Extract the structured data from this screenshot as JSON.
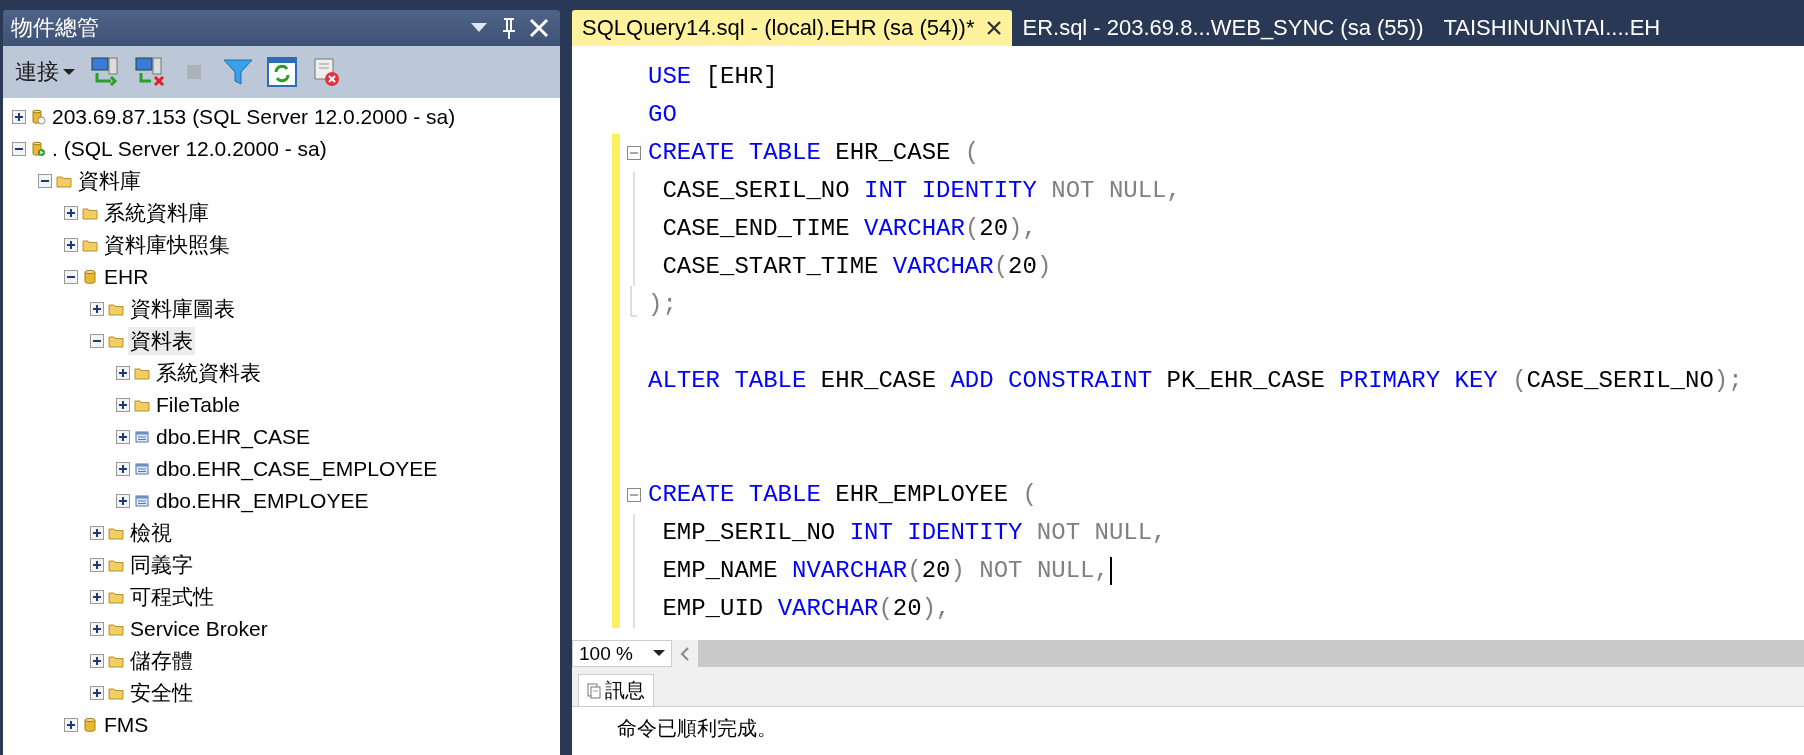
{
  "object_explorer": {
    "title": "物件總管",
    "toolbar": {
      "connect_label": "連接",
      "buttons": [
        {
          "kind": "connect",
          "disabled": false
        },
        {
          "kind": "disconnect",
          "disabled": false
        },
        {
          "kind": "stop",
          "disabled": true
        },
        {
          "kind": "filter",
          "disabled": false
        },
        {
          "kind": "refresh",
          "disabled": false
        },
        {
          "kind": "script-cancel",
          "disabled": false
        }
      ]
    },
    "tree": [
      {
        "kind": "server",
        "label": "203.69.87.153 (SQL Server 12.0.2000 - sa)",
        "expanded": false,
        "selected": false
      },
      {
        "kind": "server-connected",
        "label": ". (SQL Server 12.0.2000 - sa)",
        "expanded": true,
        "selected": false,
        "children": [
          {
            "kind": "folder",
            "label": "資料庫",
            "expanded": true,
            "selected": false,
            "children": [
              {
                "kind": "folder",
                "label": "系統資料庫",
                "expanded": false,
                "selected": false
              },
              {
                "kind": "folder",
                "label": "資料庫快照集",
                "expanded": false,
                "selected": false
              },
              {
                "kind": "database",
                "label": "EHR",
                "expanded": true,
                "selected": false,
                "children": [
                  {
                    "kind": "folder",
                    "label": "資料庫圖表",
                    "expanded": false,
                    "selected": false
                  },
                  {
                    "kind": "folder",
                    "label": "資料表",
                    "expanded": true,
                    "selected": true,
                    "children": [
                      {
                        "kind": "folder",
                        "label": "系統資料表",
                        "expanded": false,
                        "selected": false
                      },
                      {
                        "kind": "folder",
                        "label": "FileTable",
                        "expanded": false,
                        "selected": false
                      },
                      {
                        "kind": "table",
                        "label": "dbo.EHR_CASE",
                        "expanded": false,
                        "selected": false
                      },
                      {
                        "kind": "table",
                        "label": "dbo.EHR_CASE_EMPLOYEE",
                        "expanded": false,
                        "selected": false
                      },
                      {
                        "kind": "table",
                        "label": "dbo.EHR_EMPLOYEE",
                        "expanded": false,
                        "selected": false
                      }
                    ]
                  },
                  {
                    "kind": "folder",
                    "label": "檢視",
                    "expanded": false,
                    "selected": false
                  },
                  {
                    "kind": "folder",
                    "label": "同義字",
                    "expanded": false,
                    "selected": false
                  },
                  {
                    "kind": "folder",
                    "label": "可程式性",
                    "expanded": false,
                    "selected": false
                  },
                  {
                    "kind": "folder",
                    "label": "Service Broker",
                    "expanded": false,
                    "selected": false
                  },
                  {
                    "kind": "folder",
                    "label": "儲存體",
                    "expanded": false,
                    "selected": false
                  },
                  {
                    "kind": "folder",
                    "label": "安全性",
                    "expanded": false,
                    "selected": false
                  }
                ]
              },
              {
                "kind": "database",
                "label": "FMS",
                "expanded": false,
                "selected": false
              }
            ]
          }
        ]
      }
    ]
  },
  "editor_tabs": [
    {
      "label": "SQLQuery14.sql - (local).EHR (sa (54))*",
      "selected": true
    },
    {
      "label": "ER.sql - 203.69.8...WEB_SYNC (sa (55))",
      "selected": false
    },
    {
      "label": "TAISHINUNI\\TAI....EH",
      "selected": false
    }
  ],
  "code_lines": [
    {
      "changed": false,
      "kind": "code",
      "cursor": false,
      "tokens": [
        {
          "kind": "keyword",
          "text": "USE"
        },
        {
          "kind": "plain",
          "text": " [EHR]"
        }
      ]
    },
    {
      "changed": false,
      "kind": "code",
      "cursor": false,
      "tokens": [
        {
          "kind": "keyword",
          "text": "GO"
        }
      ]
    },
    {
      "changed": true,
      "kind": "fold-start",
      "cursor": false,
      "tokens": [
        {
          "kind": "keyword",
          "text": "CREATE TABLE"
        },
        {
          "kind": "plain",
          "text": " EHR_CASE "
        },
        {
          "kind": "gray",
          "text": "("
        }
      ]
    },
    {
      "changed": true,
      "kind": "fold-inner",
      "cursor": false,
      "tokens": [
        {
          "kind": "plain",
          "text": " CASE_SERIL_NO "
        },
        {
          "kind": "keyword",
          "text": "INT IDENTITY"
        },
        {
          "kind": "gray",
          "text": " NOT NULL,"
        }
      ]
    },
    {
      "changed": true,
      "kind": "fold-inner",
      "cursor": false,
      "tokens": [
        {
          "kind": "plain",
          "text": " CASE_END_TIME "
        },
        {
          "kind": "keyword",
          "text": "VARCHAR"
        },
        {
          "kind": "gray",
          "text": "("
        },
        {
          "kind": "plain",
          "text": "20"
        },
        {
          "kind": "gray",
          "text": "),"
        }
      ]
    },
    {
      "changed": true,
      "kind": "fold-inner",
      "cursor": false,
      "tokens": [
        {
          "kind": "plain",
          "text": " CASE_START_TIME "
        },
        {
          "kind": "keyword",
          "text": "VARCHAR"
        },
        {
          "kind": "gray",
          "text": "("
        },
        {
          "kind": "plain",
          "text": "20"
        },
        {
          "kind": "gray",
          "text": ")"
        }
      ]
    },
    {
      "changed": true,
      "kind": "fold-end",
      "cursor": false,
      "tokens": [
        {
          "kind": "gray",
          "text": ");"
        }
      ]
    },
    {
      "changed": true,
      "kind": "code",
      "cursor": false
    },
    {
      "changed": true,
      "kind": "code",
      "cursor": false,
      "tokens": [
        {
          "kind": "keyword",
          "text": "ALTER TABLE"
        },
        {
          "kind": "plain",
          "text": " EHR_CASE "
        },
        {
          "kind": "keyword",
          "text": "ADD CONSTRAINT"
        },
        {
          "kind": "plain",
          "text": " PK_EHR_CASE "
        },
        {
          "kind": "keyword",
          "text": "PRIMARY KEY"
        },
        {
          "kind": "gray",
          "text": " ("
        },
        {
          "kind": "plain",
          "text": "CASE_SERIL_NO"
        },
        {
          "kind": "gray",
          "text": ");"
        }
      ]
    },
    {
      "changed": true,
      "kind": "code",
      "cursor": false
    },
    {
      "changed": true,
      "kind": "code",
      "cursor": false
    },
    {
      "changed": true,
      "kind": "fold-start",
      "cursor": false,
      "tokens": [
        {
          "kind": "keyword",
          "text": "CREATE TABLE"
        },
        {
          "kind": "plain",
          "text": " EHR_EMPLOYEE "
        },
        {
          "kind": "gray",
          "text": "("
        }
      ]
    },
    {
      "changed": true,
      "kind": "fold-inner",
      "cursor": false,
      "tokens": [
        {
          "kind": "plain",
          "text": " EMP_SERIL_NO "
        },
        {
          "kind": "keyword",
          "text": "INT IDENTITY"
        },
        {
          "kind": "gray",
          "text": " NOT NULL,"
        }
      ]
    },
    {
      "changed": true,
      "kind": "fold-inner",
      "cursor": true,
      "tokens": [
        {
          "kind": "plain",
          "text": " EMP_NAME "
        },
        {
          "kind": "keyword",
          "text": "NVARCHAR"
        },
        {
          "kind": "gray",
          "text": "("
        },
        {
          "kind": "plain",
          "text": "20"
        },
        {
          "kind": "gray",
          "text": ") NOT NULL,"
        }
      ]
    },
    {
      "changed": true,
      "kind": "fold-inner",
      "cursor": false,
      "tokens": [
        {
          "kind": "plain",
          "text": " EMP_UID "
        },
        {
          "kind": "keyword",
          "text": "VARCHAR"
        },
        {
          "kind": "gray",
          "text": "("
        },
        {
          "kind": "plain",
          "text": "20"
        },
        {
          "kind": "gray",
          "text": "),"
        }
      ]
    }
  ],
  "zoom_combo": {
    "value": "100 %"
  },
  "results": {
    "tabs": [
      {
        "label": "訊息",
        "selected": true
      }
    ],
    "message": "命令已順利完成。"
  }
}
